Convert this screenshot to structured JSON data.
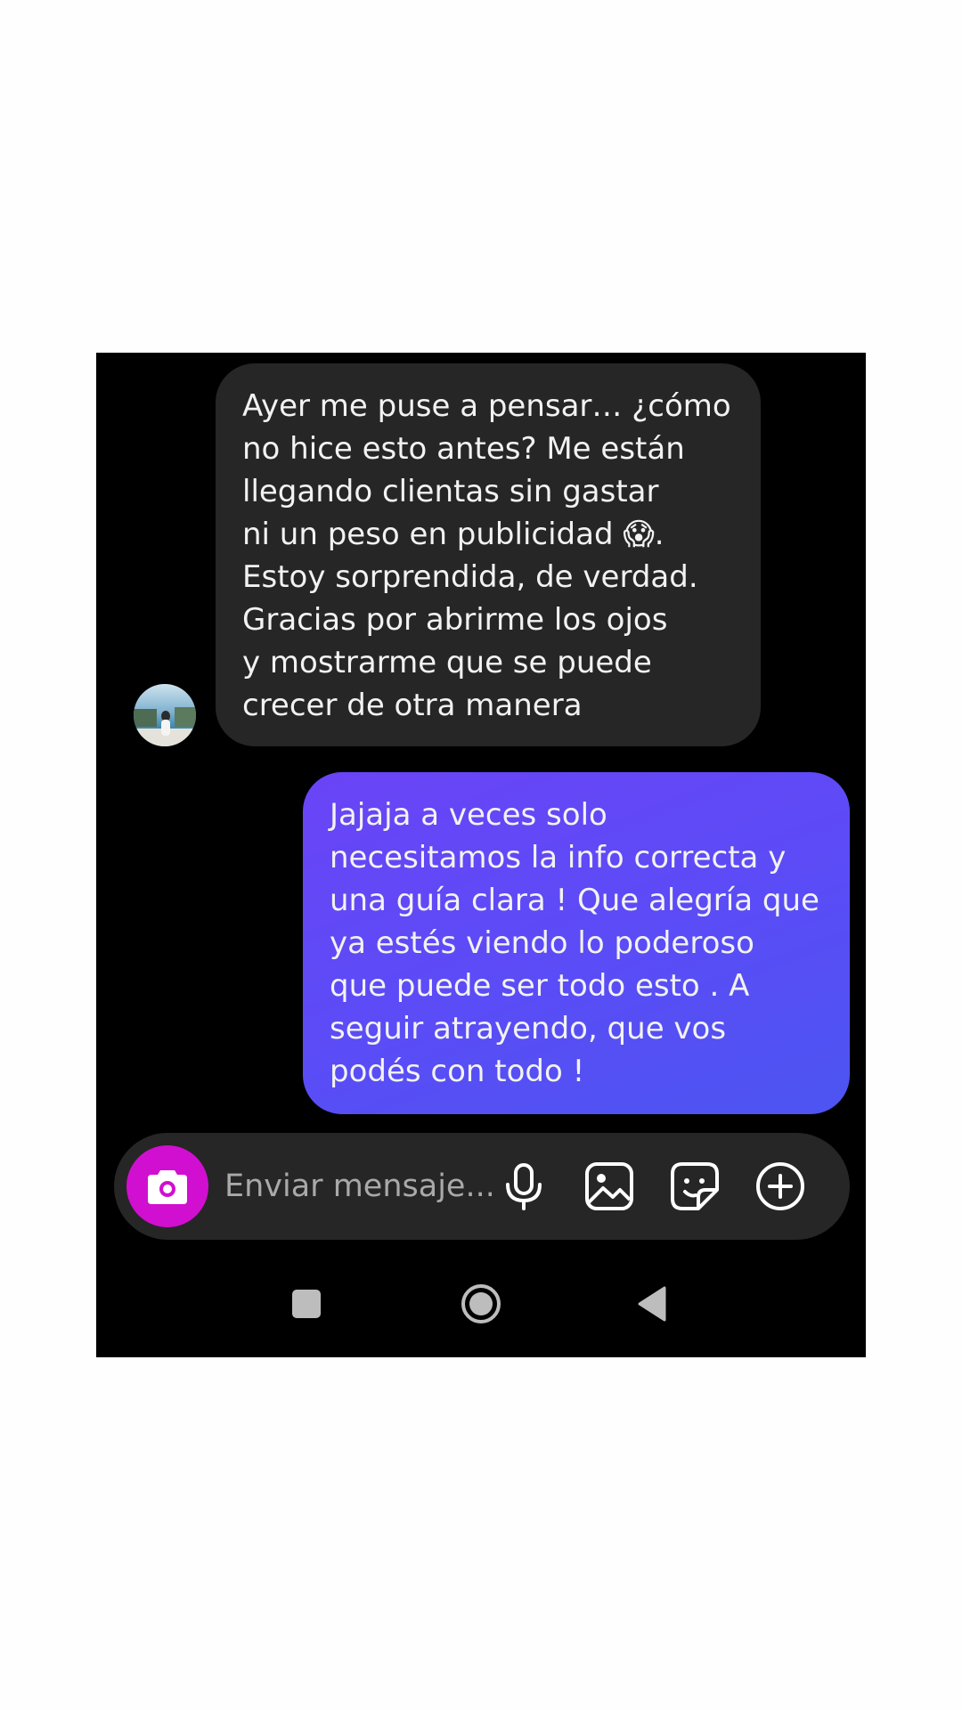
{
  "thread": {
    "incoming": {
      "text": "Ayer me puse a pensar… ¿cómo\nno hice esto antes? Me están\nllegando clientas sin gastar\nni un peso en publicidad 😱.\nEstoy sorprendida, de verdad.\nGracias por abrirme los ojos\ny mostrarme que se puede\ncrecer de otra manera"
    },
    "outgoing": {
      "text": "Jajaja a veces solo\nnecesitamos la info correcta y\nuna guía clara ! Que alegría que\nya estés viendo lo poderoso\nque puede ser todo esto . A\nseguir atrayendo, que vos\npodés con todo !"
    }
  },
  "composer": {
    "placeholder": "Enviar mensaje...",
    "icons": [
      "camera-icon",
      "microphone-icon",
      "gallery-icon",
      "sticker-icon",
      "plus-circle-icon"
    ]
  },
  "navigation": {
    "icons": [
      "recent-apps-icon",
      "home-icon",
      "back-icon"
    ]
  },
  "colors": {
    "background": "#000000",
    "incoming_bubble": "#262626",
    "outgoing_bubble": "#5a4cf6",
    "camera_button": "#d10fd0",
    "placeholder": "#a9a9a9"
  }
}
